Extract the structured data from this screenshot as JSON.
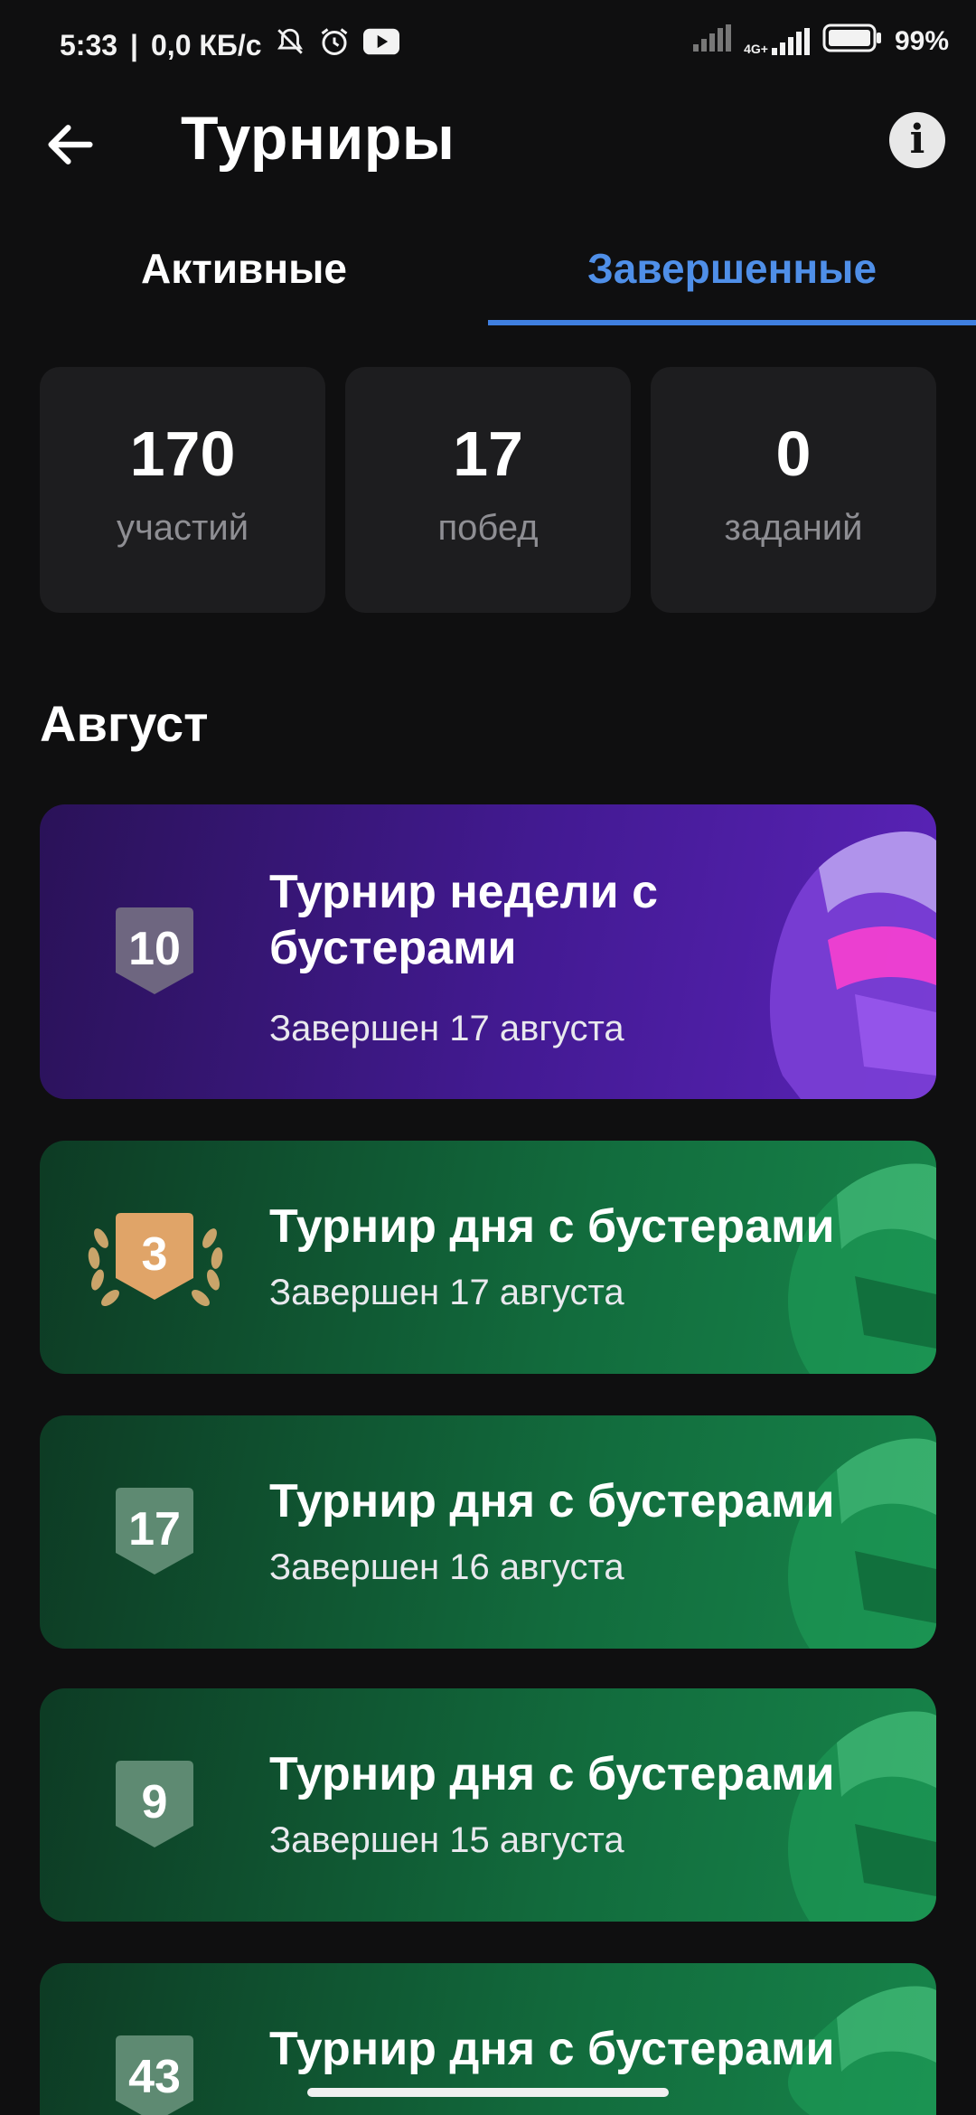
{
  "status_bar": {
    "time": "5:33",
    "speed": "0,0 КБ/с",
    "network": "4G+",
    "battery": "99%"
  },
  "app_bar": {
    "title": "Турниры"
  },
  "tabs": [
    {
      "label": "Активные"
    },
    {
      "label": "Завершенные"
    }
  ],
  "stats": [
    {
      "value": "170",
      "label": "участий"
    },
    {
      "value": "17",
      "label": "побед"
    },
    {
      "value": "0",
      "label": "заданий"
    }
  ],
  "section": {
    "month": "Август"
  },
  "tournaments": [
    {
      "place": "10",
      "title_line1": "Турнир недели с",
      "title_line2": "бустерами",
      "subtitle": "Завершен 17 августа",
      "theme": "purple"
    },
    {
      "place": "3",
      "title": "Турнир дня с бустерами",
      "subtitle": "Завершен 17 августа",
      "theme": "green-bronze"
    },
    {
      "place": "17",
      "title": "Турнир дня с бустерами",
      "subtitle": "Завершен 16 августа",
      "theme": "green"
    },
    {
      "place": "9",
      "title": "Турнир дня с бустерами",
      "subtitle": "Завершен 15 августа",
      "theme": "green"
    },
    {
      "place": "43",
      "title": "Турнир дня с бустерами",
      "subtitle": "",
      "theme": "green"
    }
  ],
  "colors": {
    "accent": "#3f7fe0",
    "card_bg": "#1d1d1f",
    "purple": "#431a93",
    "green": "#126c3d"
  }
}
